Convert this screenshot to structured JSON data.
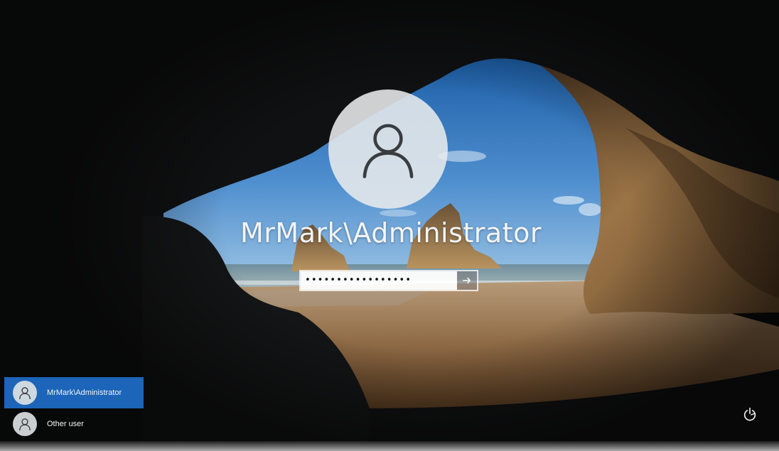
{
  "login": {
    "username": "MrMark\\Administrator",
    "password_masked": "•••••••••••••••••",
    "submit_icon": "arrow-right-icon"
  },
  "user_list": [
    {
      "label": "MrMark\\Administrator",
      "selected": true,
      "icon": "user-icon"
    },
    {
      "label": "Other user",
      "selected": false,
      "icon": "user-icon"
    }
  ],
  "corner_controls": {
    "icon": "power-accessibility-icon"
  },
  "colors": {
    "selected_user_bg": "#1e6ec8",
    "text": "#f3f4f5"
  }
}
